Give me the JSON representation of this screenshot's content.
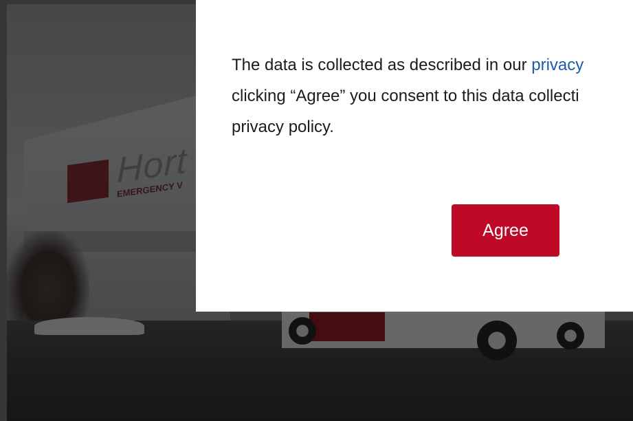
{
  "background": {
    "logo_text": "Hort",
    "logo_subtext": "EMERGENCY V"
  },
  "consent": {
    "text_before_link": "The data is collected as described in our ",
    "link_text": "privacy",
    "line2": "clicking “Agree” you consent to this data collecti",
    "line3": "privacy policy.",
    "agree_label": "Agree"
  },
  "colors": {
    "button": "#be0a26",
    "link": "#1f5ca8",
    "text": "#1b1b1b"
  }
}
